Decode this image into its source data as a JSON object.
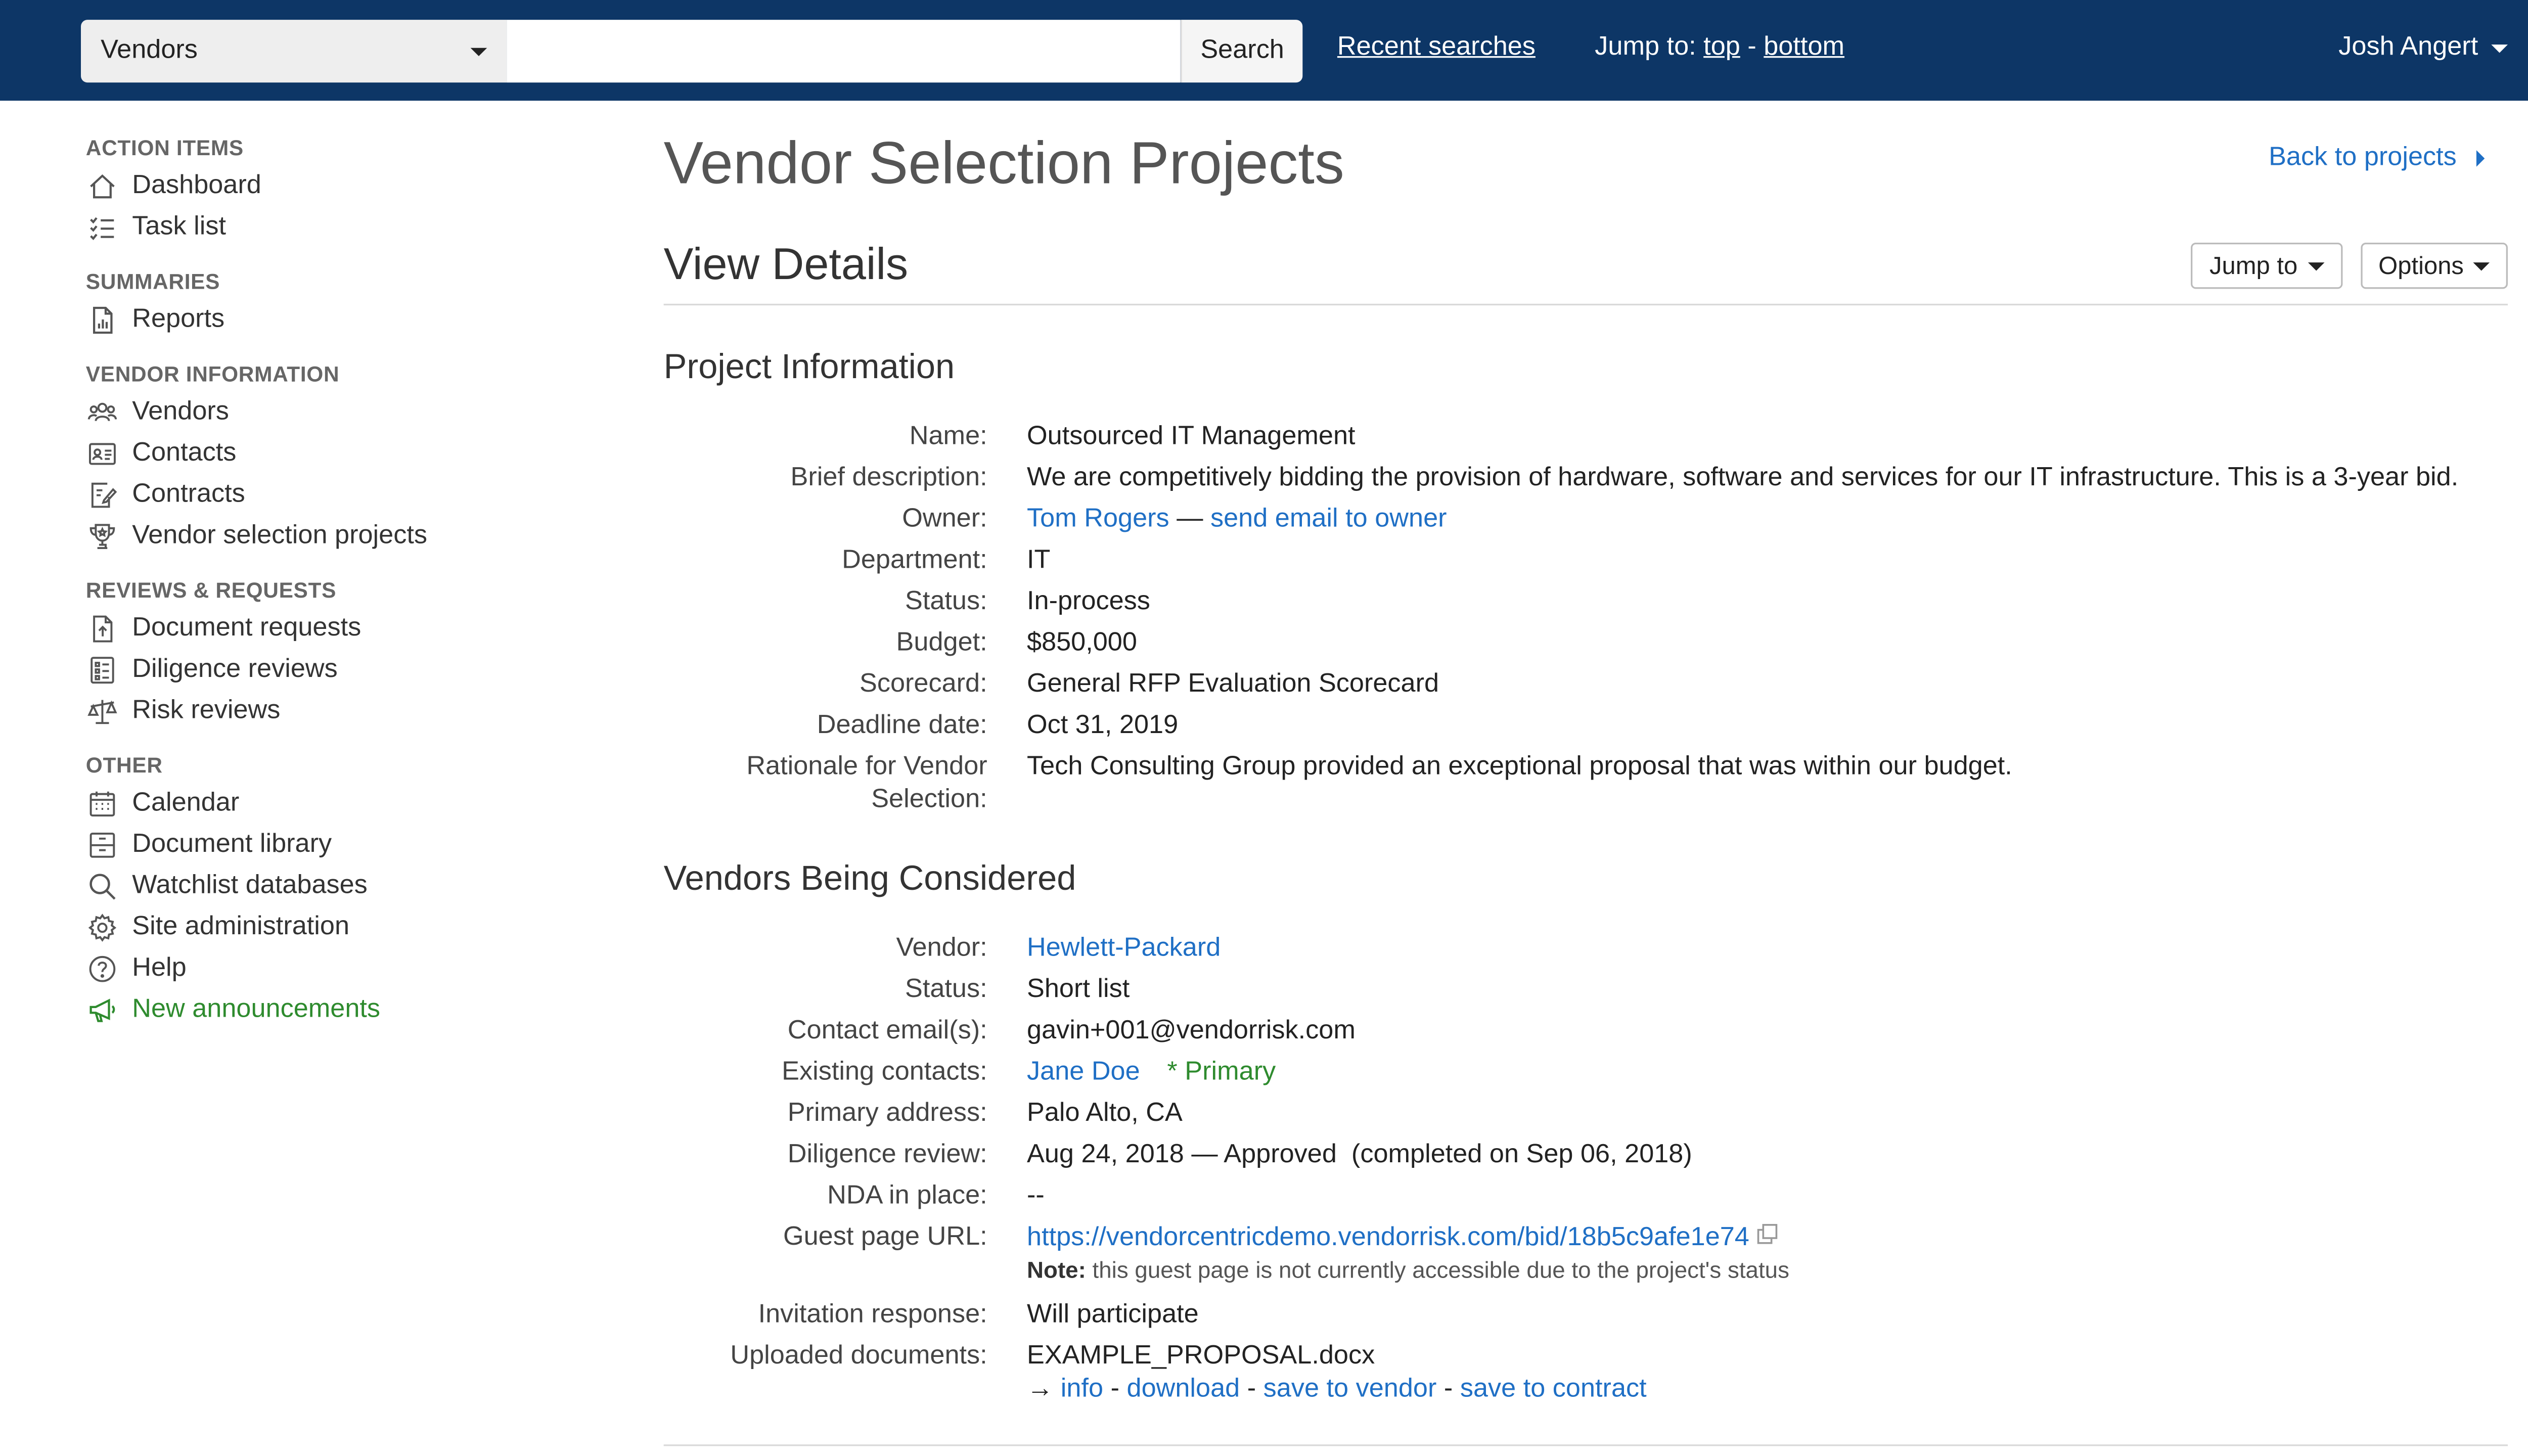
{
  "header": {
    "scope_select": "Vendors",
    "search_value": "",
    "search_button": "Search",
    "recent_searches": "Recent searches",
    "jump_label": "Jump to:",
    "jump_top": "top",
    "jump_separator": "-",
    "jump_bottom": "bottom",
    "user_name": "Josh Angert"
  },
  "sidebar": {
    "sections": [
      {
        "heading": "ACTION ITEMS",
        "items": [
          {
            "label": "Dashboard",
            "icon": "home-icon"
          },
          {
            "label": "Task list",
            "icon": "task-list-icon"
          }
        ]
      },
      {
        "heading": "SUMMARIES",
        "items": [
          {
            "label": "Reports",
            "icon": "report-icon"
          }
        ]
      },
      {
        "heading": "VENDOR INFORMATION",
        "items": [
          {
            "label": "Vendors",
            "icon": "users-icon"
          },
          {
            "label": "Contacts",
            "icon": "contact-card-icon"
          },
          {
            "label": "Contracts",
            "icon": "contract-edit-icon"
          },
          {
            "label": "Vendor selection projects",
            "icon": "trophy-icon"
          }
        ]
      },
      {
        "heading": "REVIEWS & REQUESTS",
        "items": [
          {
            "label": "Document requests",
            "icon": "document-upload-icon"
          },
          {
            "label": "Diligence reviews",
            "icon": "checklist-icon"
          },
          {
            "label": "Risk reviews",
            "icon": "scale-icon"
          }
        ]
      },
      {
        "heading": "OTHER",
        "items": [
          {
            "label": "Calendar",
            "icon": "calendar-icon"
          },
          {
            "label": "Document library",
            "icon": "archive-icon"
          },
          {
            "label": "Watchlist databases",
            "icon": "search-icon"
          },
          {
            "label": "Site administration",
            "icon": "gear-icon"
          },
          {
            "label": "Help",
            "icon": "help-icon"
          },
          {
            "label": "New announcements",
            "icon": "megaphone-icon"
          }
        ]
      }
    ]
  },
  "main": {
    "page_title": "Vendor Selection Projects",
    "back_link": "Back to projects",
    "view_title": "View Details",
    "jump_to_button": "Jump to",
    "options_button": "Options",
    "project_info": {
      "title": "Project Information",
      "name_label": "Name:",
      "name": "Outsourced IT Management",
      "description_label": "Brief description:",
      "description": "We are competitively bidding the provision of hardware, software and services for our IT infrastructure. This is a 3-year bid.",
      "owner_label": "Owner:",
      "owner": "Tom Rogers",
      "owner_dash": "—",
      "owner_email": "send email to owner",
      "department_label": "Department:",
      "department": "IT",
      "status_label": "Status:",
      "status": "In-process",
      "budget_label": "Budget:",
      "budget": "$850,000",
      "scorecard_label": "Scorecard:",
      "scorecard": "General RFP Evaluation Scorecard",
      "deadline_label": "Deadline date:",
      "deadline": "Oct 31, 2019",
      "rationale_label": "Rationale for Vendor Selection:",
      "rationale": "Tech Consulting Group provided an exceptional proposal that was within our budget."
    },
    "vendors": {
      "title": "Vendors Being Considered",
      "vendor_label": "Vendor:",
      "vendor": "Hewlett-Packard",
      "status_label": "Status:",
      "status": "Short list",
      "email_label": "Contact email(s):",
      "email": "gavin+001@vendorrisk.com",
      "contacts_label": "Existing contacts:",
      "contact": "Jane Doe",
      "contact_primary": "* Primary",
      "address_label": "Primary address:",
      "address": "Palo Alto, CA",
      "diligence_label": "Diligence review:",
      "diligence": "Aug 24, 2018 — Approved  (completed on Sep 06, 2018)",
      "nda_label": "NDA in place:",
      "nda": "--",
      "guest_url_label": "Guest page URL:",
      "guest_url": "https://vendorcentricdemo.vendorrisk.com/bid/18b5c9afe1e74",
      "note_bold": "Note:",
      "note_text": "this guest page is not currently accessible due to the project's status",
      "invitation_label": "Invitation response:",
      "invitation": "Will participate",
      "documents_label": "Uploaded documents:",
      "document": "EXAMPLE_PROPOSAL.docx",
      "doc_arrow": "→",
      "doc_info": "info",
      "doc_download": "download",
      "doc_save_vendor": "save to vendor",
      "doc_save_contract": "save to contract",
      "doc_sep": "-"
    }
  },
  "colors": {
    "topbar": "#0d3666",
    "link": "#1f6fc5",
    "green": "#2e8b2e"
  }
}
